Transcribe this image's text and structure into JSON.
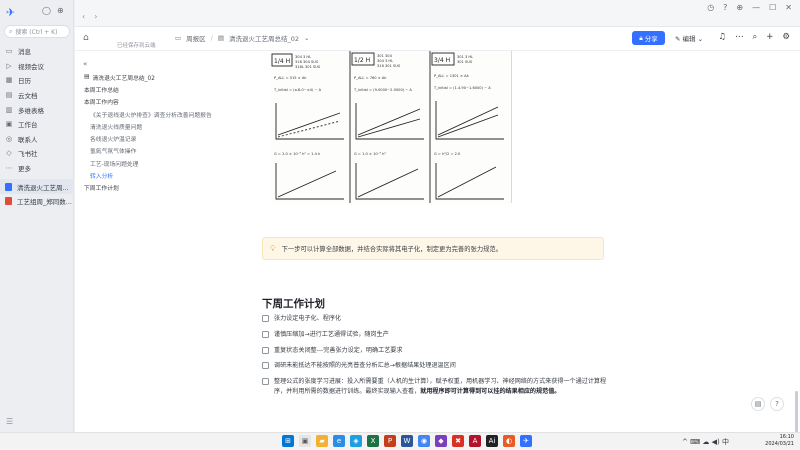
{
  "rail": {
    "search_placeholder": "搜索 (Ctrl + K)",
    "items": [
      {
        "label": "消息",
        "icon": "chat-icon"
      },
      {
        "label": "视频会议",
        "icon": "video-icon"
      },
      {
        "label": "日历",
        "icon": "calendar-icon"
      },
      {
        "label": "云文档",
        "icon": "cloud-doc-icon"
      },
      {
        "label": "多维表格",
        "icon": "table-icon"
      },
      {
        "label": "工作台",
        "icon": "workbench-icon"
      },
      {
        "label": "联系人",
        "icon": "contacts-icon"
      },
      {
        "label": "飞书社",
        "icon": "community-icon"
      },
      {
        "label": "更多",
        "icon": "more-icon"
      }
    ],
    "open_docs": [
      {
        "label": "清洗退火工艺周...",
        "color": "#3370ff"
      },
      {
        "label": "工艺组周_郑同数...",
        "color": "#e24b3c"
      }
    ]
  },
  "docbar": {
    "breadcrumb": [
      "周报区",
      "清洗退火工艺周总结_02"
    ],
    "subtitle": "已经保存到云端",
    "share_label": "分享",
    "edit_label": "编辑"
  },
  "outline": {
    "items": [
      {
        "level": "title",
        "label": "清洗退火工艺周总结_02"
      },
      {
        "level": "l1",
        "label": "本周工作总结"
      },
      {
        "level": "l1",
        "label": "本周工作内容"
      },
      {
        "level": "l2",
        "label": "《关于退线退火炉排查》调查分析改善问题报告"
      },
      {
        "level": "l2",
        "label": "清洗退火线质量问题"
      },
      {
        "level": "l2",
        "label": "各线退火炉温记录"
      },
      {
        "level": "l2",
        "label": "氢氮气氛气体操作"
      },
      {
        "level": "l2",
        "label": "工艺-现场问题处理"
      },
      {
        "level": "l2",
        "label": "转入分析",
        "active": true
      },
      {
        "level": "l1",
        "label": "下周工作计划"
      }
    ]
  },
  "content": {
    "callout": "下一步可以计算全部数据，并结合实际将其电子化，制定更为完善的张力规范。",
    "heading": "下周工作计划",
    "todos": [
      {
        "text": "张力设定电子化、程序化",
        "bold": ""
      },
      {
        "text": "谨慎压缩加→进行工艺通得试验，随岗生产",
        "bold": ""
      },
      {
        "text": "重复状态关闭整---完善张力设定，明确工艺要求",
        "bold": ""
      },
      {
        "text": "调研未能抵达不能按照的光亮普查分析汇总→根据结果处理退温区间",
        "bold": ""
      },
      {
        "text": "整理公式的张度学习进展：投入所需要重（人机的生计算），赋予权重，用机器学习、神经网络的方式来获得一个通过计算程序，并利用所需的数据进行训练。最终实现输入查看，",
        "bold": "就用程序即可计算得到可以挂的结果相应的规范值。"
      }
    ]
  },
  "sketch": {
    "panels": [
      {
        "header": "1/4 H",
        "lines": [
          "304 3 HL",
          "316 304 SUS",
          "316L 301 SUS"
        ],
        "eq1": "P_ALL = 515 × Ak",
        "eq2": "T_initial = (a.8.0~±4) ~ A"
      },
      {
        "header": "1/2 H",
        "lines": [
          "301 304",
          "304 3 HL",
          "316 301 SUS"
        ],
        "eq1": "P_ALL = 760 × Ak",
        "eq2": "T_initial = (9.0000~2.0000) ~ A"
      },
      {
        "header": "3/4 H",
        "lines": [
          "301 3 HL",
          "301 SUS"
        ],
        "eq1": "P_ALL = 1301 × Ak",
        "eq2": "T_initial = (1.4.90~1.6000) ~ A"
      }
    ],
    "bottom_eqs": [
      "G = 2.0 × 10⁻⁹ h² = 1.4 h",
      "G = 1.0 × 10⁻⁹ h²",
      "G = h²/2 = 2.0"
    ]
  },
  "taskbar": {
    "clock_time": "16:10",
    "clock_date": "2024/03/21",
    "tray_text": "^  ⌨  ☁  ◀) 中"
  }
}
